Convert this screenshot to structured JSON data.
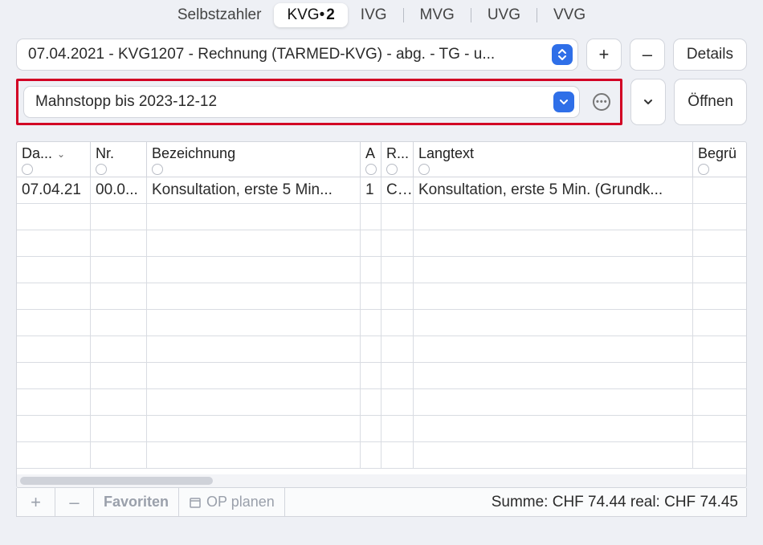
{
  "tabs": [
    {
      "label": "Selbstzahler",
      "active": false
    },
    {
      "label": "KVG",
      "badge": "2",
      "active": true
    },
    {
      "label": "IVG",
      "active": false
    },
    {
      "label": "MVG",
      "active": false
    },
    {
      "label": "UVG",
      "active": false
    },
    {
      "label": "VVG",
      "active": false
    }
  ],
  "invoice_select": {
    "value": "07.04.2021 - KVG1207 - Rechnung (TARMED-KVG) - abg. - TG - u..."
  },
  "toolbar": {
    "plus": "+",
    "minus": "–",
    "details": "Details",
    "open": "Öffnen"
  },
  "mahnstopp_select": {
    "value": "Mahnstopp bis 2023-12-12"
  },
  "columns": {
    "c0": "Da...",
    "c1": "Nr.",
    "c2": "Bezeichnung",
    "c3": "A",
    "c4": "R...",
    "c5": "Langtext",
    "c6": "Begrü"
  },
  "rows": [
    {
      "date": "07.04.21",
      "nr": "00.0...",
      "bezeichnung": "Konsultation, erste 5 Min...",
      "a": "1",
      "r": "C...",
      "langtext": "Konsultation, erste 5 Min. (Grundk...",
      "begr": ""
    }
  ],
  "empty_rows": 10,
  "footer": {
    "plus": "+",
    "minus": "–",
    "favoriten": "Favoriten",
    "op_planen": "OP planen",
    "summe": "Summe: CHF 74.44 real: CHF 74.45"
  }
}
